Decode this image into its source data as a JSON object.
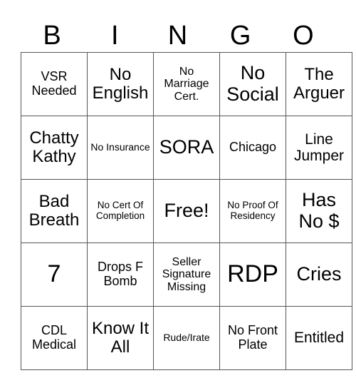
{
  "header": {
    "letters": [
      "B",
      "I",
      "N",
      "G",
      "O"
    ]
  },
  "card": {
    "rows": [
      [
        "VSR Needed",
        "No English",
        "No Marriage Cert.",
        "No Social",
        "The Arguer"
      ],
      [
        "Chatty Kathy",
        "No Insurance",
        "SORA",
        "Chicago",
        "Line Jumper"
      ],
      [
        "Bad Breath",
        "No Cert Of Completion",
        "Free!",
        "No Proof Of Residency",
        "Has No $"
      ],
      [
        "7",
        "Drops F Bomb",
        "Seller Signature Missing",
        "RDP",
        "Cries"
      ],
      [
        "CDL Medical",
        "Know It All",
        "Rude/Irate",
        "No Front Plate",
        "Entitled"
      ]
    ]
  }
}
